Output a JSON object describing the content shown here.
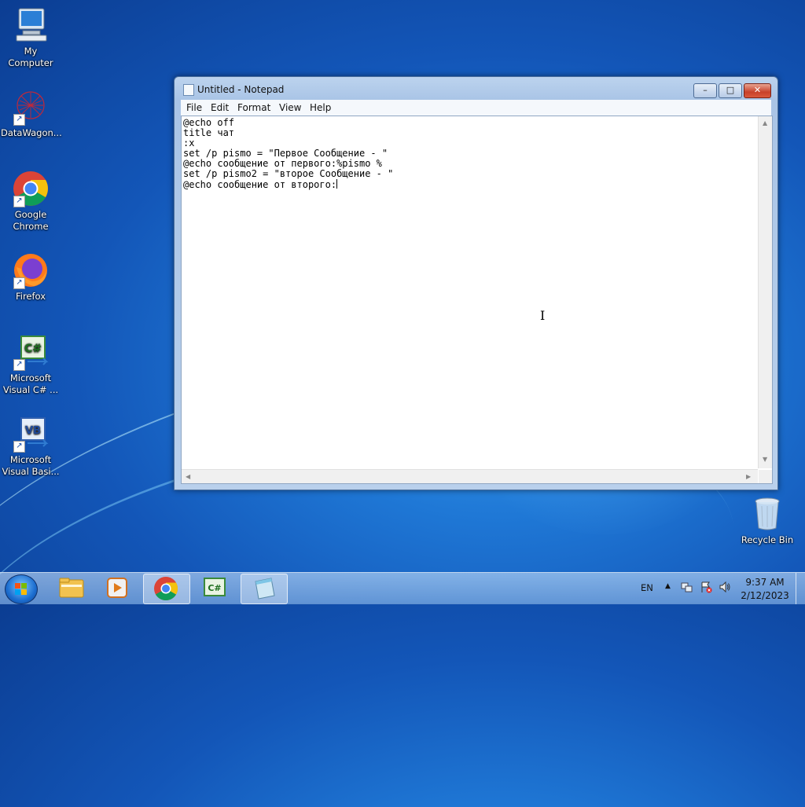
{
  "desktop": {
    "icons": [
      {
        "name": "My Computer",
        "icon": "computer-icon"
      },
      {
        "name": "DataWagon...",
        "icon": "datawagon-icon"
      },
      {
        "name": "Google Chrome",
        "icon": "chrome-icon"
      },
      {
        "name": "Firefox",
        "icon": "firefox-icon"
      },
      {
        "name": "Microsoft Visual C# ...",
        "icon": "visual-csharp-icon"
      },
      {
        "name": "Microsoft Visual Basi...",
        "icon": "visual-basic-icon"
      },
      {
        "name": "Recycle Bin",
        "icon": "recycle-bin-icon"
      }
    ]
  },
  "notepad": {
    "title": "Untitled - Notepad",
    "controls": {
      "minimize": "–",
      "maximize": "□",
      "close": "✕"
    },
    "menu": [
      "File",
      "Edit",
      "Format",
      "View",
      "Help"
    ],
    "lines": [
      "@echo off",
      "title чат",
      ":x",
      "set /p pismo = \"Первое Сообщение - \"",
      "@echo сообщение от первого:%pismo %",
      "set /p pismo2 = \"второе Сообщение - \"",
      "@echo сообщение от второго:"
    ]
  },
  "taskbar": {
    "start_icon": "windows-start-icon",
    "pinned": [
      {
        "name": "explorer",
        "icon": "folder-icon"
      },
      {
        "name": "media-player",
        "icon": "media-player-icon"
      },
      {
        "name": "chrome",
        "icon": "chrome-icon"
      },
      {
        "name": "visual-csharp",
        "icon": "visual-csharp-icon"
      },
      {
        "name": "notepad",
        "icon": "notepad-icon"
      }
    ],
    "language": "EN",
    "time": "9:37 AM",
    "date": "2/12/2023"
  },
  "colors": {
    "desktop_blue": "#1f78d6",
    "close_red": "#c8412a",
    "accent": "#1356b8"
  }
}
